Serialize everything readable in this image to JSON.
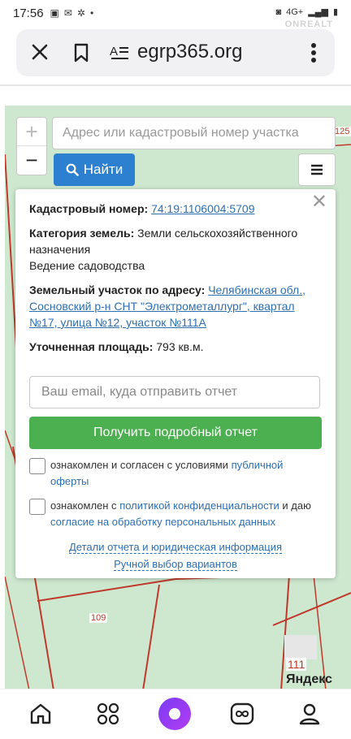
{
  "status_bar": {
    "time": "17:56",
    "network": "4G+"
  },
  "watermark": "ONREALT",
  "browser": {
    "url": "egrp365.org"
  },
  "map": {
    "search_placeholder": "Адрес или кадастровый номер участка",
    "find_label": "Найти",
    "zoom_in": "+",
    "zoom_out": "−",
    "labels": [
      "125",
      "109",
      "111"
    ],
    "provider": "Яндекс"
  },
  "card": {
    "cadastral_label": "Кадастровый номер:",
    "cadastral_value": "74:19:1106004:5709",
    "category_label": "Категория земель:",
    "category_value": "Земли сельскохозяйственного назначения",
    "usage": "Ведение садоводства",
    "address_label": "Земельный участок по адресу:",
    "address_value": "Челябинская обл., Сосновский р-н СНТ \"Электрометаллург\", квартал №17, улица №12, участок №111А",
    "area_label": "Уточненная площадь:",
    "area_value": "793 кв.м.",
    "email_placeholder": "Ваш email, куда отправить отчет",
    "get_report": "Получить подробный отчет",
    "consent1_text": "ознакомлен и согласен с условиями ",
    "consent1_link": "публичной оферты",
    "consent2_text_a": "ознакомлен с ",
    "consent2_link_a": "политикой конфиденциальности",
    "consent2_text_b": " и даю ",
    "consent2_link_b": "согласие на обработку персональных данных",
    "details_link": "Детали отчета и юридическая информация",
    "manual_link": "Ручной выбор вариантов"
  },
  "colors": {
    "accent_blue": "#2d7fd0",
    "green": "#4caf50",
    "map_bg": "#cde8cf",
    "boundary": "#c0392b"
  }
}
